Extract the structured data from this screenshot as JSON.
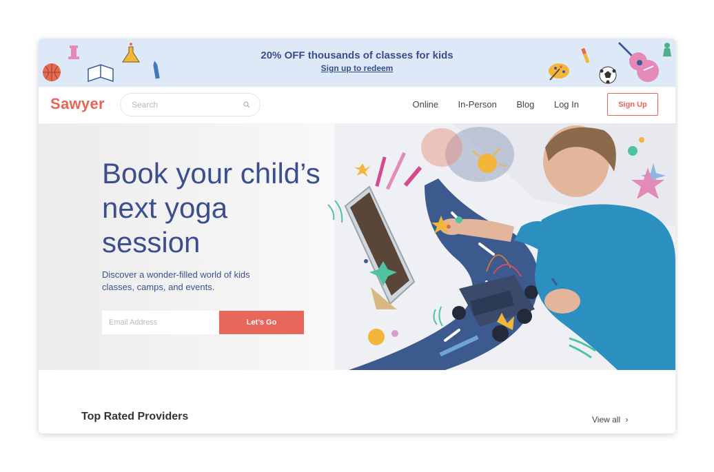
{
  "promo": {
    "title": "20% OFF thousands of classes for kids",
    "link_label": "Sign up to redeem"
  },
  "nav": {
    "logo": "Sawyer",
    "search_placeholder": "Search",
    "links": [
      "Online",
      "In-Person",
      "Blog",
      "Log In"
    ],
    "signup_label": "Sign Up"
  },
  "hero": {
    "headline": "Book your child’s next yoga session",
    "subtext": "Discover a wonder-filled world of kids classes, camps, and events.",
    "email_placeholder": "Email Address",
    "cta_label": "Let’s Go"
  },
  "providers": {
    "title": "Top Rated Providers",
    "view_all_label": "View all"
  },
  "colors": {
    "brand": "#e86456",
    "navy": "#3c4f8c",
    "banner_bg": "#dde9f7",
    "cta": "#e8665a"
  },
  "icons": [
    "rook-icon",
    "basketball-icon",
    "book-icon",
    "flask-icon",
    "crayon-icon",
    "palette-icon",
    "test-tube-icon",
    "soccer-ball-icon",
    "guitar-icon",
    "search-icon",
    "chevron-right-icon"
  ]
}
